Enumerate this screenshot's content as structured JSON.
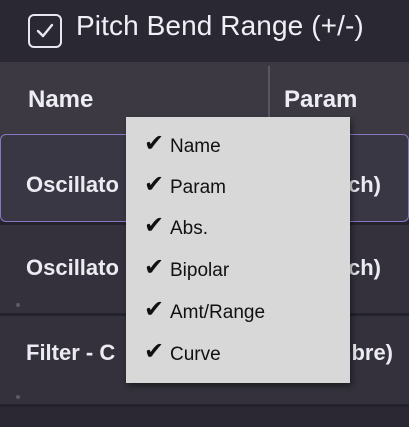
{
  "title": {
    "checked": true,
    "label": "Pitch Bend Range (+/-)"
  },
  "table": {
    "columns": [
      "Name",
      "Param"
    ],
    "rows": [
      {
        "name": "Oscillato",
        "param": "ch)",
        "selected": true
      },
      {
        "name": "Oscillato",
        "param": "ch)",
        "selected": false
      },
      {
        "name": "Filter - C",
        "param": "nbre)",
        "selected": false
      }
    ]
  },
  "context_menu": {
    "items": [
      {
        "label": "Name",
        "checked": true
      },
      {
        "label": "Param",
        "checked": true
      },
      {
        "label": "Abs.",
        "checked": true
      },
      {
        "label": "Bipolar",
        "checked": true
      },
      {
        "label": "Amt/Range",
        "checked": true
      },
      {
        "label": "Curve",
        "checked": true
      }
    ],
    "check_glyph": "✔"
  },
  "colors": {
    "background": "#2a2833",
    "header": "#3c3942",
    "row": "#34313c",
    "selection_border": "#8a76c0",
    "menu_bg": "#d8d8d8"
  }
}
